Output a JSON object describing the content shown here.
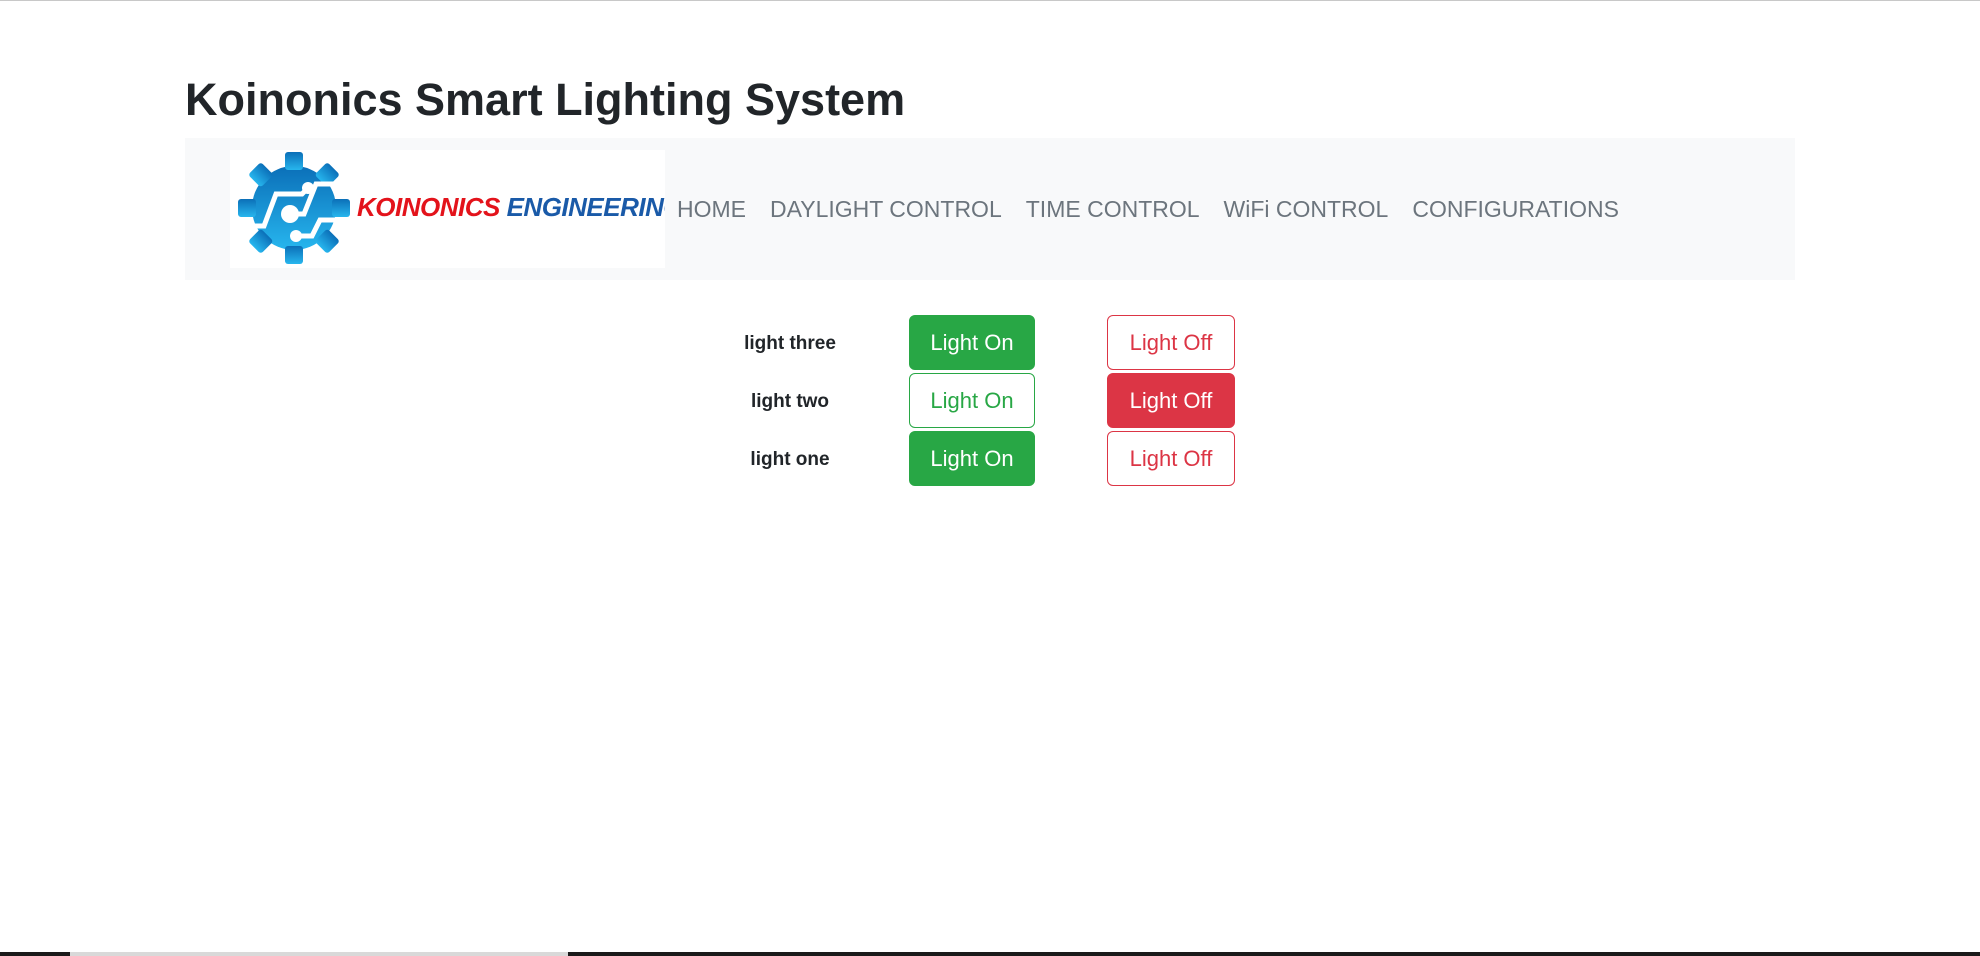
{
  "page": {
    "title": "Koinonics Smart Lighting System"
  },
  "logo": {
    "text_red": "KOINONICS",
    "text_blue": "ENGINEERING",
    "icon": "gear-circuit-icon",
    "colors": {
      "red": "#e3131b",
      "blue": "#1a5aa8",
      "gear": "#1ea0dc"
    }
  },
  "nav": {
    "items": [
      {
        "label": "HOME"
      },
      {
        "label": "DAYLIGHT CONTROL"
      },
      {
        "label": "TIME CONTROL"
      },
      {
        "label": "WiFi CONTROL"
      },
      {
        "label": "CONFIGURATIONS"
      }
    ]
  },
  "lights": [
    {
      "label": "light three",
      "on_label": "Light On",
      "off_label": "Light Off",
      "state": "on"
    },
    {
      "label": "light two",
      "on_label": "Light On",
      "off_label": "Light Off",
      "state": "off"
    },
    {
      "label": "light one",
      "on_label": "Light On",
      "off_label": "Light Off",
      "state": "on"
    }
  ],
  "colors": {
    "success": "#28a745",
    "danger": "#dc3545",
    "nav_bg": "#f8f9fa",
    "nav_text": "#6c757d"
  }
}
